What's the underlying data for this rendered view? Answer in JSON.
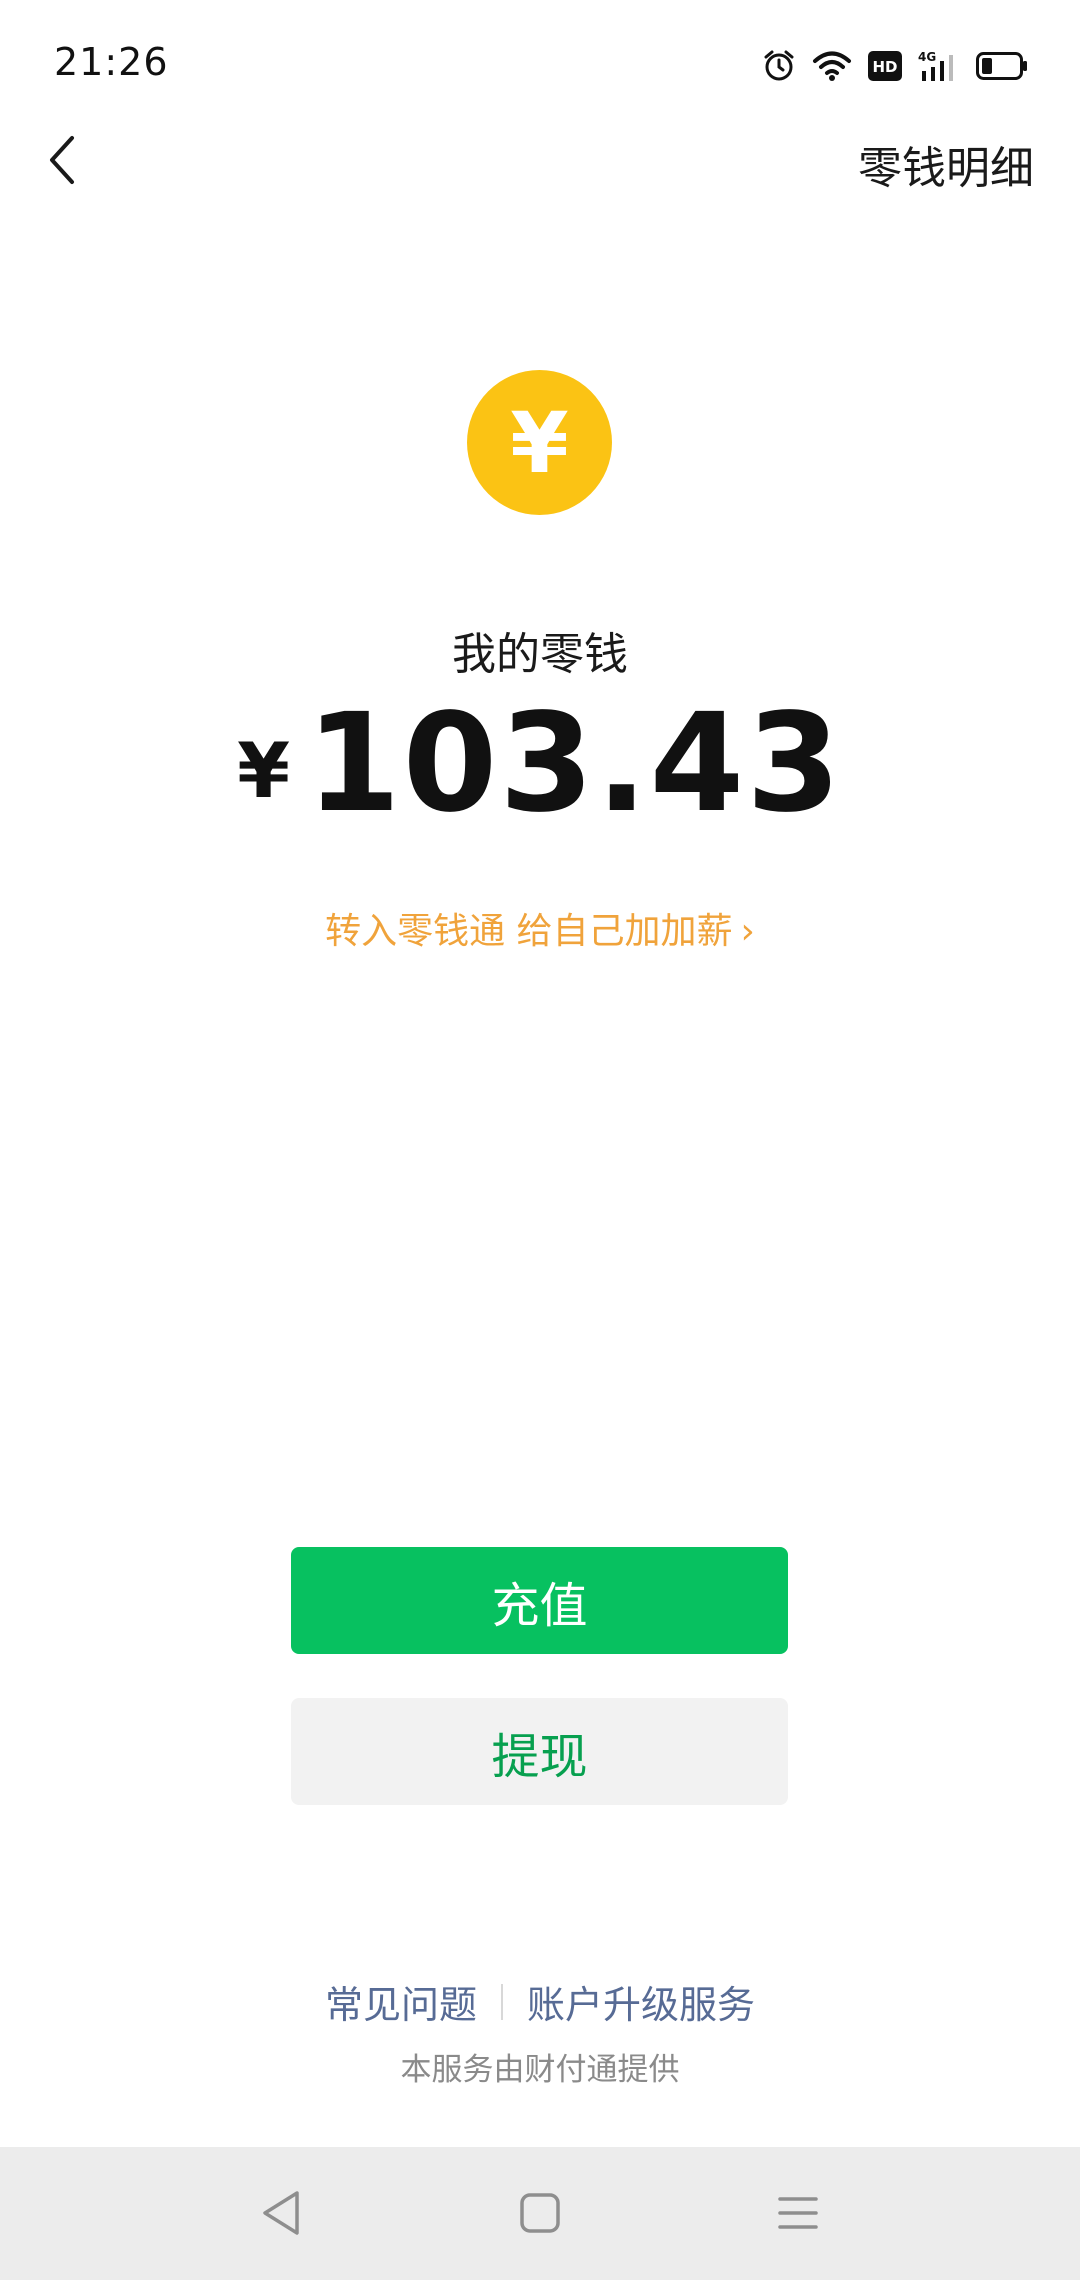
{
  "status_bar": {
    "time": "21:26",
    "icons": [
      "alarm-icon",
      "wifi-icon",
      "hd-icon",
      "signal-4g-icon",
      "battery-icon"
    ],
    "hd_label": "HD",
    "network_label": "4G"
  },
  "header": {
    "back_icon": "chevron-left-icon",
    "detail_label": "零钱明细"
  },
  "balance": {
    "coin_symbol": "¥",
    "label": "我的零钱",
    "currency": "¥",
    "amount": "103.43"
  },
  "promo": {
    "text": "转入零钱通 给自己加加薪",
    "arrow": "›"
  },
  "actions": {
    "topup_label": "充值",
    "withdraw_label": "提现"
  },
  "footer": {
    "faq_label": "常见问题",
    "upgrade_label": "账户升级服务",
    "provider_text": "本服务由财付通提供"
  },
  "colors": {
    "accent_green": "#07c160",
    "coin_yellow": "#fbc314",
    "promo_orange": "#f0a33b",
    "link_blue": "#576b95"
  }
}
